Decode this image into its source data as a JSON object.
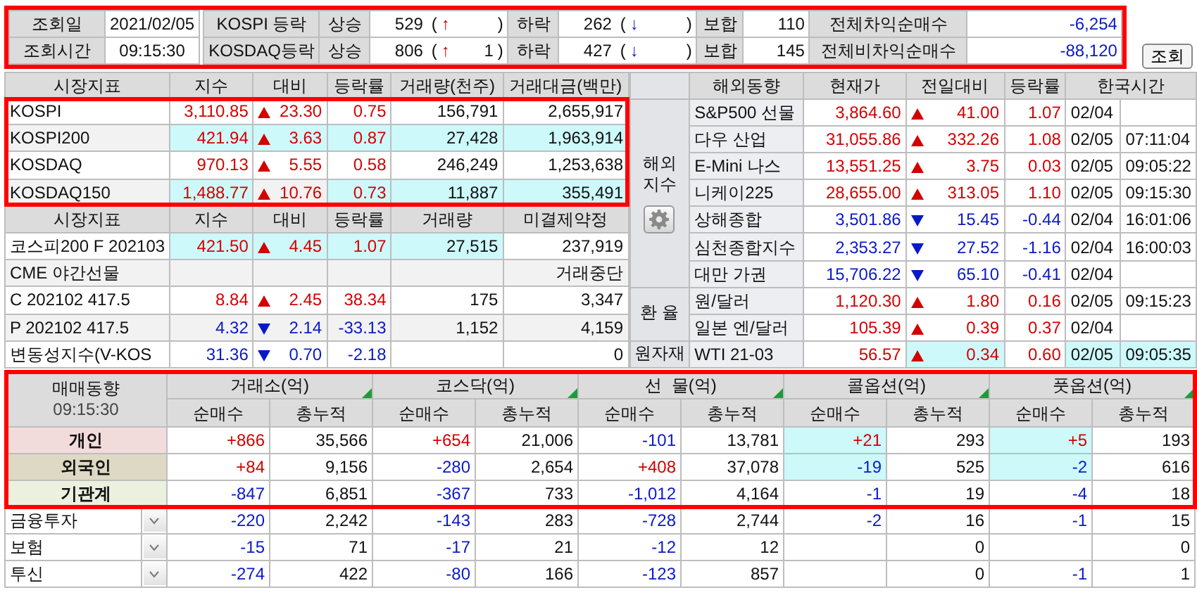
{
  "top_bar": {
    "highlighted": true,
    "rows": [
      {
        "label": "조회일",
        "value": "2021/02/05",
        "market": "KOSPI 등락",
        "rise_label": "상승",
        "rise": "529",
        "rise_limit": {
          "open": "(",
          "arrow": "↑",
          "close": ")"
        },
        "fall_label": "하락",
        "fall": "262",
        "fall_limit": {
          "open": "(",
          "arrow": "↓",
          "close": ")"
        },
        "flat_label": "보합",
        "flat": "110",
        "program_label": "전체차익순매수",
        "program": {
          "value": "-6,254",
          "color": "#0a19c8"
        }
      },
      {
        "label": "조회시간",
        "value": "09:15:30",
        "market": "KOSDAQ등락",
        "rise_label": "상승",
        "rise": "806",
        "rise_limit": {
          "open": "(",
          "arrow": "↑",
          "count": "1",
          "close": ")"
        },
        "fall_label": "하락",
        "fall": "427",
        "fall_limit": {
          "open": "(",
          "arrow": "↓",
          "close": ")"
        },
        "flat_label": "보합",
        "flat": "145",
        "program_label": "전체비차익순매수",
        "program": {
          "value": "-88,120",
          "color": "#0a19c8"
        }
      }
    ]
  },
  "query_button": "조회",
  "domestic": {
    "highlighted": true,
    "columns": [
      "시장지표",
      "지수",
      "대비",
      "등락률",
      "거래량(천주)",
      "거래대금(백만)"
    ],
    "rows": [
      {
        "name": "KOSPI",
        "color": "#d40000",
        "rising": true,
        "index": "3,110.85",
        "change": "23.30",
        "rate": "0.75",
        "volume": "156,791",
        "amount": "2,655,917",
        "updated": [
          false,
          false,
          false,
          false,
          false
        ]
      },
      {
        "name": "KOSPI200",
        "color": "#d40000",
        "rising": true,
        "index": "421.94",
        "change": "3.63",
        "rate": "0.87",
        "volume": "27,428",
        "amount": "1,963,914",
        "updated": [
          true,
          true,
          true,
          true,
          true
        ]
      },
      {
        "name": "KOSDAQ",
        "color": "#d40000",
        "rising": true,
        "index": "970.13",
        "change": "5.55",
        "rate": "0.58",
        "volume": "246,249",
        "amount": "1,253,638",
        "updated": [
          false,
          false,
          false,
          false,
          false
        ]
      },
      {
        "name": "KOSDAQ150",
        "color": "#d40000",
        "rising": true,
        "index": "1,488.77",
        "change": "10.76",
        "rate": "0.73",
        "volume": "11,887",
        "amount": "355,491",
        "updated": [
          true,
          false,
          true,
          true,
          true
        ]
      }
    ]
  },
  "derivatives": {
    "columns": [
      "시장지표",
      "지수",
      "대비",
      "등락률",
      "거래량",
      "미결제약정"
    ],
    "rows": [
      {
        "name": "코스피200 F 202103",
        "color": "#d40000",
        "rising": true,
        "index": "421.50",
        "change": "4.45",
        "rate": "1.07",
        "volume": "27,515",
        "open_interest": "237,919",
        "updated": [
          true,
          true,
          true,
          true,
          false
        ]
      },
      {
        "name": "CME 야간선물",
        "open_interest": "거래중단",
        "updated": [
          false,
          false,
          false,
          false,
          false
        ]
      },
      {
        "name": "C 202102 417.5",
        "color": "#d40000",
        "rising": true,
        "index": "8.84",
        "change": "2.45",
        "rate": "38.34",
        "volume": "175",
        "open_interest": "3,347",
        "updated": [
          false,
          false,
          false,
          false,
          false
        ]
      },
      {
        "name": "P 202102 417.5",
        "color": "#0a19c8",
        "rising": false,
        "index": "4.32",
        "change": "2.14",
        "rate": "-33.13",
        "volume": "1,152",
        "open_interest": "4,159",
        "updated": [
          false,
          false,
          false,
          false,
          false
        ]
      },
      {
        "name": "변동성지수(V-KOS",
        "color": "#0a19c8",
        "rising": false,
        "index": "31.36",
        "change": "0.70",
        "rate": "-2.18",
        "open_interest": "0",
        "updated": [
          false,
          false,
          false,
          false,
          false
        ]
      }
    ]
  },
  "overseas": {
    "columns": [
      "해외동향",
      "현재가",
      "전일대비",
      "등락률",
      "한국시간"
    ],
    "groups": [
      {
        "label": "해외 지수",
        "settings": true,
        "rows": [
          {
            "name": "S&P500 선물",
            "color": "#d40000",
            "rising": true,
            "price": "3,864.60",
            "change": "41.00",
            "rate": "1.07",
            "date": "02/04",
            "updated": [
              false,
              false,
              false,
              false,
              false
            ]
          },
          {
            "name": "다우 산업",
            "color": "#d40000",
            "rising": true,
            "price": "31,055.86",
            "change": "332.26",
            "rate": "1.08",
            "date": "02/05",
            "time": "07:11:04",
            "updated": [
              false,
              false,
              false,
              false,
              false
            ]
          },
          {
            "name": "E-Mini 나스",
            "color": "#d40000",
            "rising": true,
            "price": "13,551.25",
            "change": "3.75",
            "rate": "0.03",
            "date": "02/05",
            "time": "09:05:22",
            "updated": [
              false,
              false,
              false,
              false,
              false
            ]
          },
          {
            "name": "니케이225",
            "color": "#d40000",
            "rising": true,
            "price": "28,655.00",
            "change": "313.05",
            "rate": "1.10",
            "date": "02/05",
            "time": "09:15:30",
            "updated": [
              false,
              false,
              false,
              false,
              false
            ]
          },
          {
            "name": "상해종합",
            "color": "#0a19c8",
            "rising": false,
            "price": "3,501.86",
            "change": "15.45",
            "rate": "-0.44",
            "date": "02/04",
            "time": "16:01:06",
            "updated": [
              false,
              false,
              false,
              false,
              false
            ]
          },
          {
            "name": "심천종합지수",
            "color": "#0a19c8",
            "rising": false,
            "price": "2,353.27",
            "change": "27.52",
            "rate": "-1.16",
            "date": "02/04",
            "time": "16:00:03",
            "updated": [
              false,
              false,
              false,
              false,
              false
            ]
          },
          {
            "name": "대만 가권",
            "color": "#0a19c8",
            "rising": false,
            "price": "15,706.22",
            "change": "65.10",
            "rate": "-0.41",
            "date": "02/04",
            "updated": [
              false,
              false,
              false,
              false,
              false
            ]
          }
        ]
      },
      {
        "label": "환 율",
        "settings": false,
        "rows": [
          {
            "name": "원/달러",
            "color": "#d40000",
            "rising": true,
            "price": "1,120.30",
            "change": "1.80",
            "rate": "0.16",
            "date": "02/05",
            "time": "09:15:23",
            "updated": [
              false,
              false,
              false,
              false,
              false
            ]
          },
          {
            "name": "일본 엔/달러",
            "color": "#d40000",
            "rising": true,
            "price": "105.39",
            "change": "0.39",
            "rate": "0.37",
            "date": "02/04",
            "updated": [
              false,
              false,
              false,
              false,
              false
            ]
          }
        ]
      },
      {
        "label": "원자재",
        "settings": false,
        "rows": [
          {
            "name": "WTI 21-03",
            "color": "#d40000",
            "rising": true,
            "price": "56.57",
            "change": "0.34",
            "rate": "0.60",
            "date": "02/05",
            "time": "09:05:35",
            "updated": [
              false,
              true,
              false,
              true,
              true
            ]
          }
        ]
      }
    ]
  },
  "investors": {
    "highlighted": true,
    "title": "매매동향",
    "time": "09:15:30",
    "groups": [
      {
        "title": "거래소(억)",
        "columns": [
          "순매수",
          "총누적"
        ]
      },
      {
        "title": "코스닥(억)",
        "columns": [
          "순매수",
          "총누적"
        ]
      },
      {
        "title": "선  물(억)",
        "columns": [
          "순매수",
          "총누적"
        ]
      },
      {
        "title": "콜옵션(억)",
        "columns": [
          "순매수",
          "총누적"
        ]
      },
      {
        "title": "풋옵션(억)",
        "columns": [
          "순매수",
          "총누적"
        ]
      }
    ],
    "rows": [
      {
        "name": "개인",
        "kind": "summary",
        "color": "#f2dcdb",
        "cells": [
          {
            "net": "+866",
            "color": "#d40000",
            "total": "35,566",
            "updated": false
          },
          {
            "net": "+654",
            "color": "#d40000",
            "total": "21,006",
            "updated": false
          },
          {
            "net": "-101",
            "color": "#0a19c8",
            "total": "13,781",
            "updated": false
          },
          {
            "net": "+21",
            "color": "#d40000",
            "total": "293",
            "updated": true
          },
          {
            "net": "+5",
            "color": "#d40000",
            "total": "193",
            "updated": true
          }
        ]
      },
      {
        "name": "외국인",
        "kind": "summary",
        "color": "#ddd9c4",
        "cells": [
          {
            "net": "+84",
            "color": "#d40000",
            "total": "9,156",
            "updated": false
          },
          {
            "net": "-280",
            "color": "#0a19c8",
            "total": "2,654",
            "updated": false
          },
          {
            "net": "+408",
            "color": "#d40000",
            "total": "37,078",
            "updated": false
          },
          {
            "net": "-19",
            "color": "#0a19c8",
            "total": "525",
            "updated": true
          },
          {
            "net": "-2",
            "color": "#0a19c8",
            "total": "616",
            "updated": true
          }
        ]
      },
      {
        "name": "기관계",
        "kind": "summary",
        "color": "#ebf1de",
        "cells": [
          {
            "net": "-847",
            "color": "#0a19c8",
            "total": "6,851",
            "updated": false
          },
          {
            "net": "-367",
            "color": "#0a19c8",
            "total": "733",
            "updated": false
          },
          {
            "net": "-1,012",
            "color": "#0a19c8",
            "total": "4,164",
            "updated": false
          },
          {
            "net": "-1",
            "color": "#0a19c8",
            "total": "19",
            "updated": false
          },
          {
            "net": "-4",
            "color": "#0a19c8",
            "total": "18",
            "updated": false
          }
        ]
      },
      {
        "name": "금융투자",
        "kind": "detail",
        "cells": [
          {
            "net": "-220",
            "color": "#0a19c8",
            "total": "2,242",
            "updated": false
          },
          {
            "net": "-143",
            "color": "#0a19c8",
            "total": "283",
            "updated": false
          },
          {
            "net": "-728",
            "color": "#0a19c8",
            "total": "2,744",
            "updated": false
          },
          {
            "net": "-2",
            "color": "#0a19c8",
            "total": "16",
            "updated": false
          },
          {
            "net": "-1",
            "color": "#0a19c8",
            "total": "15",
            "updated": false
          }
        ]
      },
      {
        "name": "보험",
        "kind": "detail",
        "cells": [
          {
            "net": "-15",
            "color": "#0a19c8",
            "total": "71",
            "updated": false
          },
          {
            "net": "-17",
            "color": "#0a19c8",
            "total": "21",
            "updated": false
          },
          {
            "net": "-12",
            "color": "#0a19c8",
            "total": "12",
            "updated": false
          },
          {
            "total": "0",
            "updated": false
          },
          {
            "total": "0",
            "updated": false
          }
        ]
      },
      {
        "name": "투신",
        "kind": "detail",
        "cells": [
          {
            "net": "-274",
            "color": "#0a19c8",
            "total": "422",
            "updated": false
          },
          {
            "net": "-80",
            "color": "#0a19c8",
            "total": "166",
            "updated": false
          },
          {
            "net": "-123",
            "color": "#0a19c8",
            "total": "857",
            "updated": false
          },
          {
            "total": "0",
            "updated": false
          },
          {
            "net": "-1",
            "color": "#0a19c8",
            "total": "1",
            "updated": false
          }
        ]
      }
    ]
  }
}
